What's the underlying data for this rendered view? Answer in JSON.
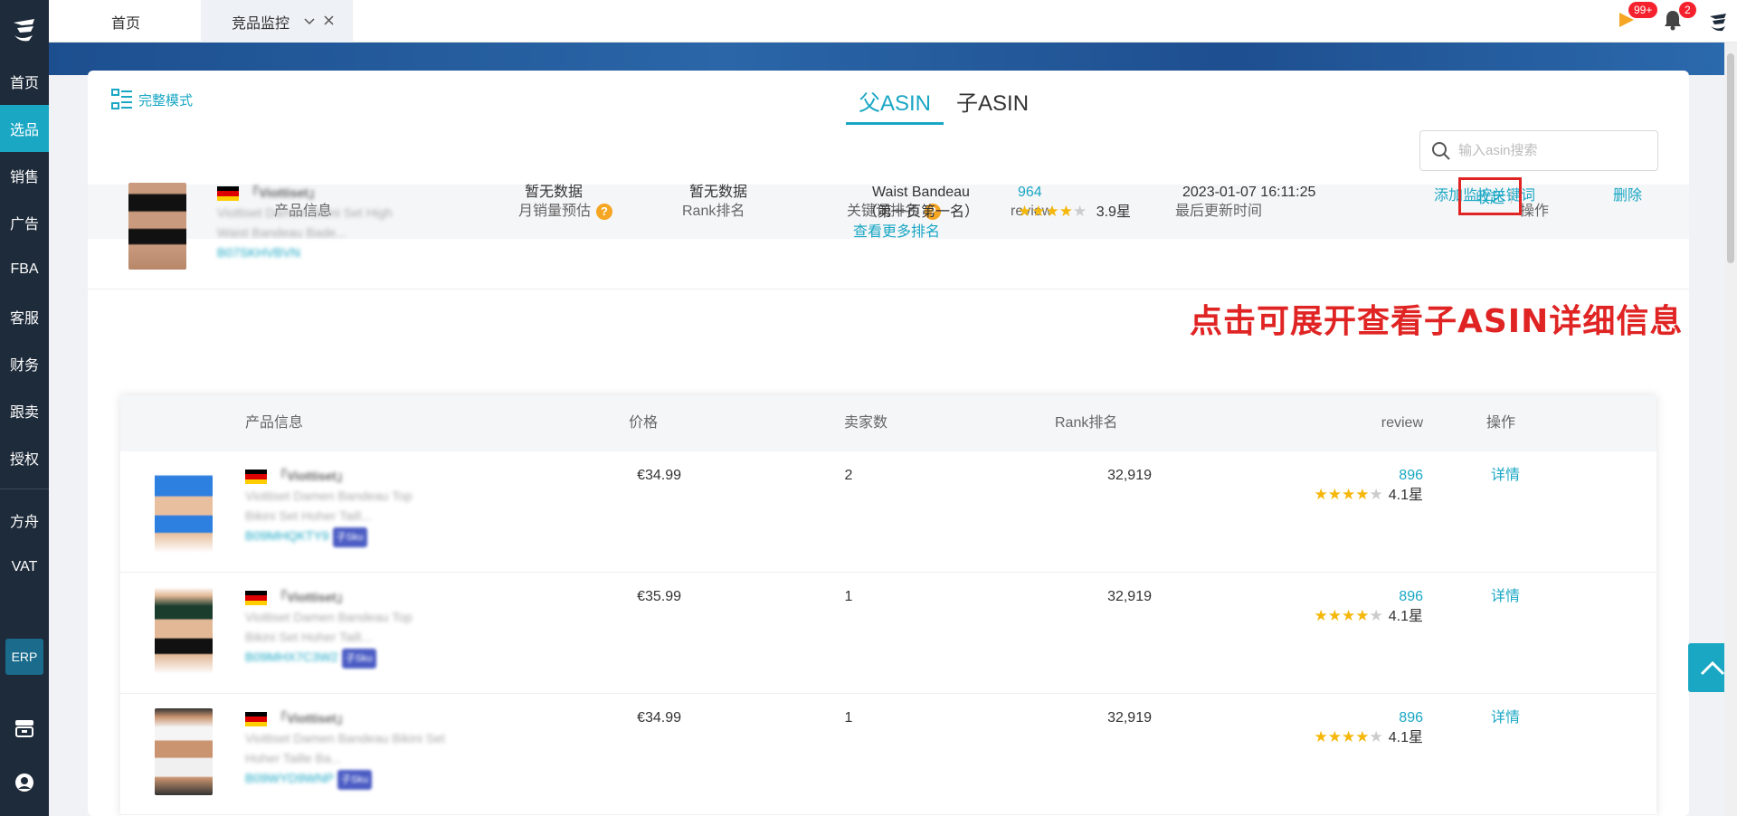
{
  "sidebar": {
    "items": [
      {
        "label": "首页",
        "active": false
      },
      {
        "label": "选品",
        "active": true
      },
      {
        "label": "销售",
        "active": false
      },
      {
        "label": "广告",
        "active": false
      },
      {
        "label": "FBA",
        "active": false
      },
      {
        "label": "客服",
        "active": false
      },
      {
        "label": "财务",
        "active": false
      },
      {
        "label": "跟卖",
        "active": false
      },
      {
        "label": "授权",
        "active": false
      }
    ],
    "items2": [
      {
        "label": "方舟"
      },
      {
        "label": "VAT"
      }
    ],
    "erp_label": "ERP"
  },
  "tabs": {
    "home": "首页",
    "monitor": "竞品监控"
  },
  "notifications": {
    "flag_badge": "99+",
    "bell_badge": "2"
  },
  "header": {
    "mode_label": "完整模式",
    "tab_parent": "父ASIN",
    "tab_child": "子ASIN",
    "search_placeholder": "输入asin搜索"
  },
  "parent_table": {
    "columns": {
      "product": "产品信息",
      "monthly_sales": "月销量预估",
      "rank": "Rank排名",
      "keyword_rank": "关键词排名",
      "review": "review",
      "updated": "最后更新时间",
      "ops": "操作"
    },
    "help_glyph": "?",
    "row": {
      "brand": "「Viottiset」",
      "title_1": "Viottiset Damen Bikini Set High",
      "title_2": "Waist Bandeau Bade...",
      "asin": "B07SKHVBVN",
      "monthly_sales": "暂无数据",
      "rank": "暂无数据",
      "keyword": "Waist Bandeau",
      "keyword_pos": "（第一页第一名）",
      "more_rank": "查看更多排名",
      "review_count": "964",
      "rating": 3.9,
      "rating_text": "3.9星",
      "updated": "2023-01-07 16:11:25",
      "op_add_keyword": "添加监控关键词",
      "op_collapse": "收起",
      "op_delete": "删除"
    }
  },
  "annotation": "点击可展开查看子ASIN详细信息",
  "child_table": {
    "columns": {
      "product": "产品信息",
      "price": "价格",
      "sellers": "卖家数",
      "rank": "Rank排名",
      "review": "review",
      "ops": "操作"
    },
    "rows": [
      {
        "brand": "「Viottiset」",
        "title_1": "Viottiset Damen Bandeau Top",
        "title_2": "Bikini Set Hoher Taill...",
        "asin": "B09MHQKTY9",
        "tag": "子Sku",
        "price": "€34.99",
        "sellers": "2",
        "rank": "32,919",
        "review_count": "896",
        "rating": 4.1,
        "rating_text": "4.1星",
        "op": "详情"
      },
      {
        "brand": "「Viottiset」",
        "title_1": "Viottiset Damen Bandeau Top",
        "title_2": "Bikini Set Hoher Taill...",
        "asin": "B09MHX7C3W2",
        "tag": "子Sku",
        "price": "€35.99",
        "sellers": "1",
        "rank": "32,919",
        "review_count": "896",
        "rating": 4.1,
        "rating_text": "4.1星",
        "op": "详情"
      },
      {
        "brand": "「Viottiset」",
        "title_1": "Viottiset Damen Bandeau Bikini Set",
        "title_2": "Hoher Taille Ba...",
        "asin": "B09WYD9WNP",
        "tag": "子Sku",
        "price": "€34.99",
        "sellers": "1",
        "rank": "32,919",
        "review_count": "896",
        "rating": 4.1,
        "rating_text": "4.1星",
        "op": "详情"
      }
    ]
  },
  "colors": {
    "accent": "#19a7c4",
    "sidebar_bg": "#1e2b3a",
    "annotation_red": "#e02424",
    "star": "#f5b70a"
  }
}
